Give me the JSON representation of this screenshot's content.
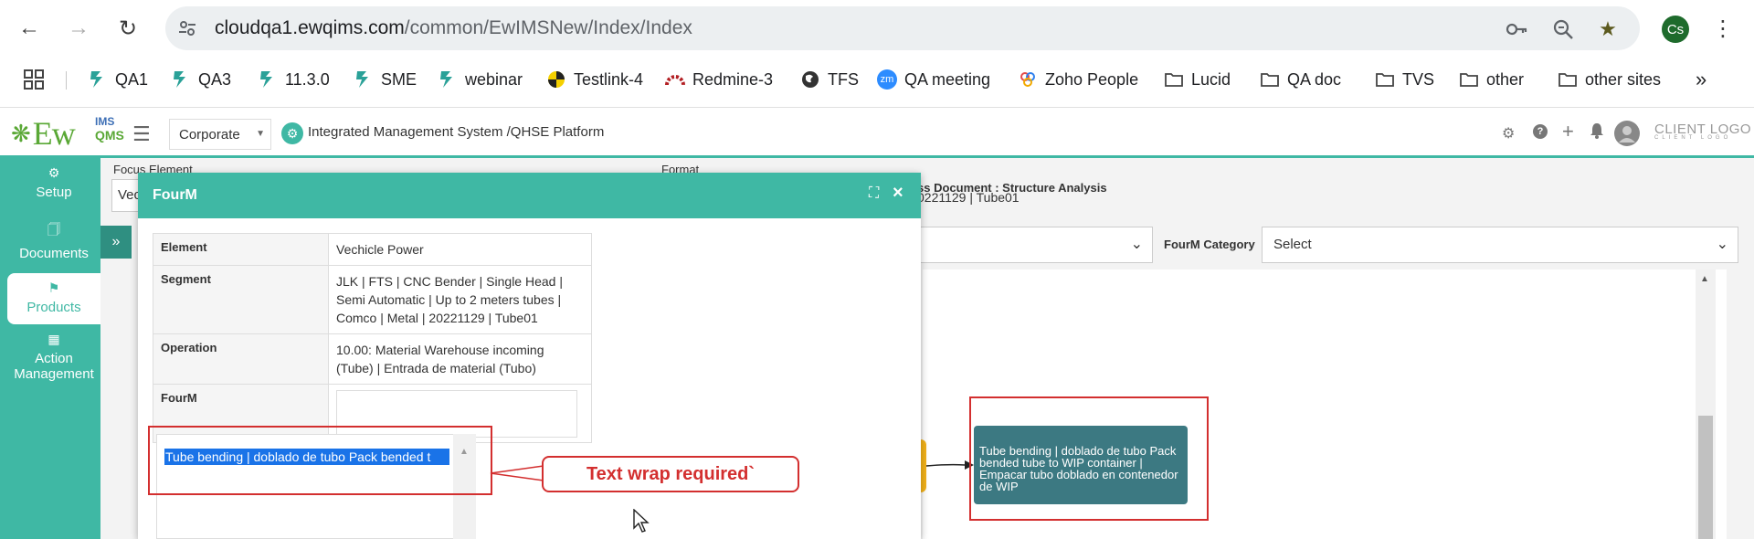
{
  "browser": {
    "url_host": "cloudqa1.ewqims.com",
    "url_path": "/common/EwIMSNew/Index/Index",
    "profile_initials": "Cs",
    "bookmarks": [
      {
        "label": "QA1"
      },
      {
        "label": "QA3"
      },
      {
        "label": "11.3.0"
      },
      {
        "label": "SME"
      },
      {
        "label": "webinar"
      },
      {
        "label": "Testlink-4"
      },
      {
        "label": "Redmine-3"
      },
      {
        "label": "TFS"
      },
      {
        "label": "QA meeting"
      },
      {
        "label": "Zoho People"
      },
      {
        "label": "Lucid"
      },
      {
        "label": "QA doc"
      },
      {
        "label": "TVS"
      },
      {
        "label": "other"
      },
      {
        "label": "other sites"
      }
    ]
  },
  "app": {
    "logo_ew": "Ew",
    "logo_ims": "IMS",
    "logo_qms": "QMS",
    "corporate": "Corporate",
    "platform_title": "Integrated Management System /QHSE Platform",
    "client_logo": "CLIENT LOGO",
    "client_logo_sub": "CLIENT LOGO"
  },
  "sidebar": {
    "items": [
      {
        "label": "Setup"
      },
      {
        "label": "Documents"
      },
      {
        "label": "Products"
      },
      {
        "label": "Action Management"
      }
    ]
  },
  "background": {
    "focus_element_label": "Focus Element",
    "focus_element_value": "Vec",
    "format_label": "Format",
    "process_doc": "ss Document : Structure Analysis",
    "process_doc_sub": "0221129 | Tube01",
    "fourm_category_label": "FourM Category",
    "fourm_category_value": "Select",
    "node_text": "Tube bending | doblado de tubo Pack bended tube to WIP container | Empacar tubo doblado en contenedor de WIP"
  },
  "modal": {
    "title": "FourM",
    "rows": [
      {
        "key": "Element",
        "value": "Vechicle Power"
      },
      {
        "key": "Segment",
        "value": "JLK | FTS | CNC Bender | Single Head | Semi Automatic | Up to 2 meters tubes | Comco | Metal | 20221129 | Tube01"
      },
      {
        "key": "Operation",
        "value": "10.00: Material Warehouse incoming (Tube) | Entrada de material (Tubo)"
      },
      {
        "key": "FourM",
        "value": ""
      }
    ],
    "editor_text": "Tube bending | doblado de tubo Pack bended t"
  },
  "annotation": {
    "callout": "Text wrap required`"
  }
}
